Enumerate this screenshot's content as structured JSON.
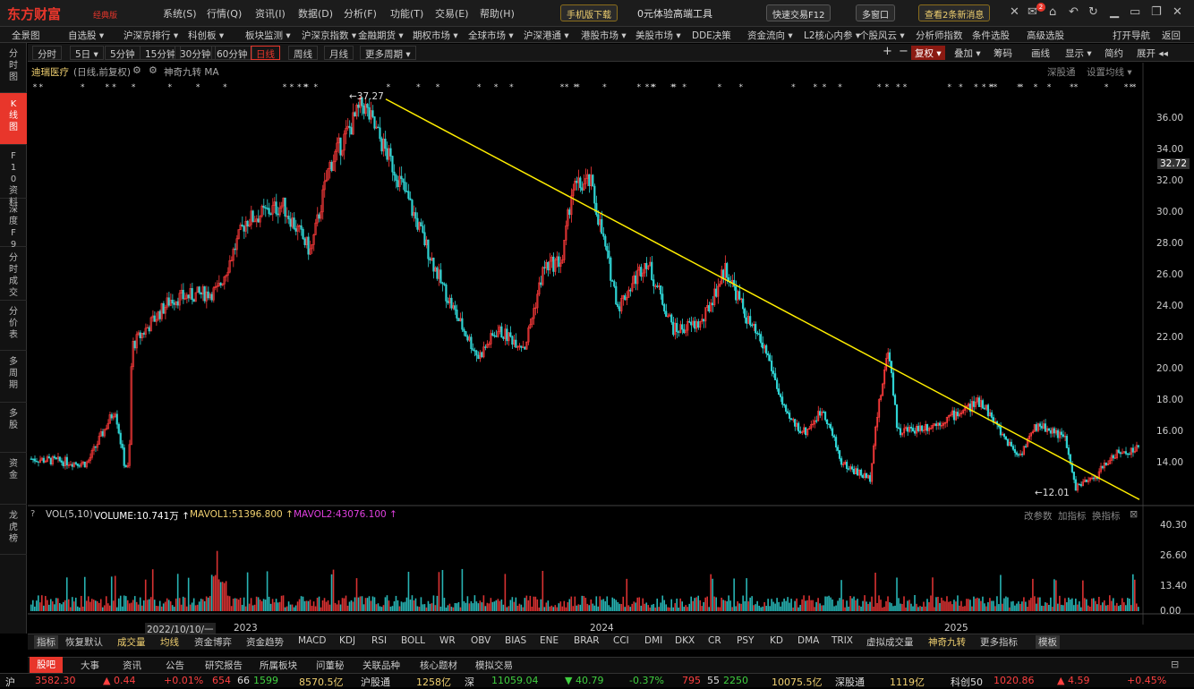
{
  "app": {
    "logo": "东方财富",
    "edition": "经典版"
  },
  "menu": [
    "系统(S)",
    "行情(Q)",
    "资讯(I)",
    "数据(D)",
    "分析(F)",
    "功能(T)",
    "交易(E)",
    "帮助(H)"
  ],
  "top_actions": {
    "mobile": "手机版下载",
    "promo": "0元体验高端工具",
    "quick_trade": "快速交易F12",
    "multi_window": "多窗口",
    "news": "查看2条新消息",
    "mail_badge": "2"
  },
  "nav": [
    "全景图",
    "自选股 ▾",
    "沪深京排行 ▾",
    "科创板 ▾",
    "板块监测 ▾",
    "沪深京指数 ▾",
    "金融期货 ▾",
    "期权市场 ▾",
    "全球市场 ▾",
    "沪深港通 ▾",
    "港股市场 ▾",
    "美股市场 ▾",
    "DDE决策",
    "资金流向 ▾",
    "L2核心内参 ▾",
    "个股风云 ▾",
    "分析师指数",
    "条件选股",
    "高级选股",
    "打开导航",
    "返回"
  ],
  "sidebar": [
    "分时图",
    "K线图",
    "F10资料",
    "深度F9",
    "分时成交",
    "分价表",
    "多周期",
    "多股",
    "资金",
    "龙虎榜"
  ],
  "periods": [
    "分时",
    "5日 ▾",
    "5分钟",
    "15分钟",
    "30分钟",
    "60分钟",
    "日线",
    "周线",
    "月线",
    "更多周期 ▾"
  ],
  "period_active": "日线",
  "right_tools": {
    "plus": "+",
    "minus": "−",
    "fuquan": "复权 ▾",
    "add": "叠加 ▾",
    "chips": "筹码",
    "draw": "画线",
    "display": "显示 ▾",
    "simple": "简约",
    "expand": "展开 ◂◂"
  },
  "stock": {
    "name": "迪瑞医疗",
    "meta": "(日线,前复权)",
    "indicators": "神奇九转  MA",
    "shengu": "深股通",
    "set_ma": "设置均线 ▾"
  },
  "price_axis": [
    "36.00",
    "34.00",
    "32.00",
    "30.00",
    "28.00",
    "26.00",
    "24.00",
    "22.00",
    "20.00",
    "18.00",
    "16.00",
    "14.00"
  ],
  "current_price": "32.72",
  "annotations": {
    "high": "←37.27",
    "low": "←12.01"
  },
  "vol_header": {
    "label": "VOL(5,10)",
    "volume": "VOLUME:10.741万 ↑",
    "mavol1": "MAVOL1:51396.800 ↑",
    "mavol2": "MAVOL2:43076.100 ↑",
    "params": "改参数",
    "add_ind": "加指标",
    "switch_ind": "换指标"
  },
  "vol_axis": [
    "40.30",
    "26.60",
    "13.40",
    "0.00"
  ],
  "time_axis": {
    "start": "2022/10/10/一",
    "y2023": "2023",
    "y2024": "2024",
    "y2025": "2025"
  },
  "indicator_tabs": [
    "指标",
    "恢复默认",
    "成交量",
    "均线",
    "资金博弈",
    "资金趋势",
    "MACD",
    "KDJ",
    "RSI",
    "BOLL",
    "WR",
    "OBV",
    "BIAS",
    "ENE",
    "BRAR",
    "CCI",
    "DMI",
    "DKX",
    "CR",
    "PSY",
    "KD",
    "DMA",
    "TRIX",
    "虚拟成交量",
    "神奇九转",
    "更多指标",
    "模板"
  ],
  "bottom_tabs": [
    "股吧",
    "大事",
    "资讯",
    "公告",
    "研究报告",
    "所属板块",
    "问董秘",
    "关联品种",
    "核心题材",
    "模拟交易"
  ],
  "status": [
    {
      "t": "沪",
      "c": "wh"
    },
    {
      "t": "3582.30",
      "c": "up"
    },
    {
      "t": "▲ 0.44",
      "c": "up"
    },
    {
      "t": "+0.01%",
      "c": "up"
    },
    {
      "t": "654",
      "c": "up"
    },
    {
      "t": "66",
      "c": "wh"
    },
    {
      "t": "1599",
      "c": "dn"
    },
    {
      "t": "8570.5亿",
      "c": "yl"
    },
    {
      "t": "沪股通",
      "c": "wh"
    },
    {
      "t": "1258亿",
      "c": "yl"
    },
    {
      "t": "深",
      "c": "wh"
    },
    {
      "t": "11059.04",
      "c": "dn"
    },
    {
      "t": "▼ 40.79",
      "c": "dn"
    },
    {
      "t": "-0.37%",
      "c": "dn"
    },
    {
      "t": "795",
      "c": "up"
    },
    {
      "t": "55",
      "c": "wh"
    },
    {
      "t": "2250",
      "c": "dn"
    },
    {
      "t": "10075.5亿",
      "c": "yl"
    },
    {
      "t": "深股通",
      "c": "wh"
    },
    {
      "t": "1119亿",
      "c": "yl"
    },
    {
      "t": "科创50",
      "c": "wh"
    },
    {
      "t": "1020.86",
      "c": "up"
    },
    {
      "t": "▲ 4.59",
      "c": "up"
    },
    {
      "t": "+0.45%",
      "c": "up"
    }
  ],
  "chart_data": {
    "type": "candlestick",
    "price_range": [
      12.0,
      38.0
    ],
    "trendline": [
      [
        0.356,
        37.27
      ],
      [
        1.0,
        11.7
      ]
    ],
    "x_labels": [
      "2022/10/10/一",
      "2023",
      "2024",
      "2025"
    ],
    "high": 37.27,
    "low": 12.01,
    "last": 32.72,
    "key_points": [
      [
        0.0,
        14.3
      ],
      [
        0.06,
        14.0
      ],
      [
        0.09,
        17.5
      ],
      [
        0.1,
        14.0
      ],
      [
        0.105,
        13.6
      ],
      [
        0.108,
        21.5
      ],
      [
        0.15,
        24.5
      ],
      [
        0.2,
        25.0
      ],
      [
        0.23,
        29.5
      ],
      [
        0.27,
        30.5
      ],
      [
        0.3,
        27.5
      ],
      [
        0.32,
        33.0
      ],
      [
        0.356,
        37.0
      ],
      [
        0.38,
        34.0
      ],
      [
        0.4,
        31.5
      ],
      [
        0.44,
        25.5
      ],
      [
        0.46,
        23.0
      ],
      [
        0.48,
        20.8
      ],
      [
        0.5,
        22.5
      ],
      [
        0.53,
        21.5
      ],
      [
        0.55,
        26.5
      ],
      [
        0.57,
        27.0
      ],
      [
        0.58,
        31.5
      ],
      [
        0.6,
        32.0
      ],
      [
        0.63,
        24.0
      ],
      [
        0.66,
        27.0
      ],
      [
        0.69,
        22.5
      ],
      [
        0.72,
        23.0
      ],
      [
        0.745,
        26.5
      ],
      [
        0.77,
        23.0
      ],
      [
        0.79,
        21.0
      ],
      [
        0.81,
        17.0
      ],
      [
        0.83,
        16.0
      ],
      [
        0.85,
        17.5
      ],
      [
        0.87,
        14.0
      ],
      [
        0.9,
        13.0
      ],
      [
        0.905,
        16.0
      ],
      [
        0.92,
        21.5
      ],
      [
        0.93,
        16.0
      ],
      [
        0.97,
        16.5
      ],
      [
        1.02,
        18.0
      ],
      [
        1.04,
        16.0
      ],
      [
        1.06,
        14.5
      ],
      [
        1.08,
        16.5
      ],
      [
        1.1,
        16.0
      ],
      [
        1.11,
        15.5
      ],
      [
        1.12,
        12.5
      ],
      [
        1.14,
        13.0
      ],
      [
        1.16,
        14.5
      ],
      [
        1.19,
        15.0
      ]
    ]
  }
}
